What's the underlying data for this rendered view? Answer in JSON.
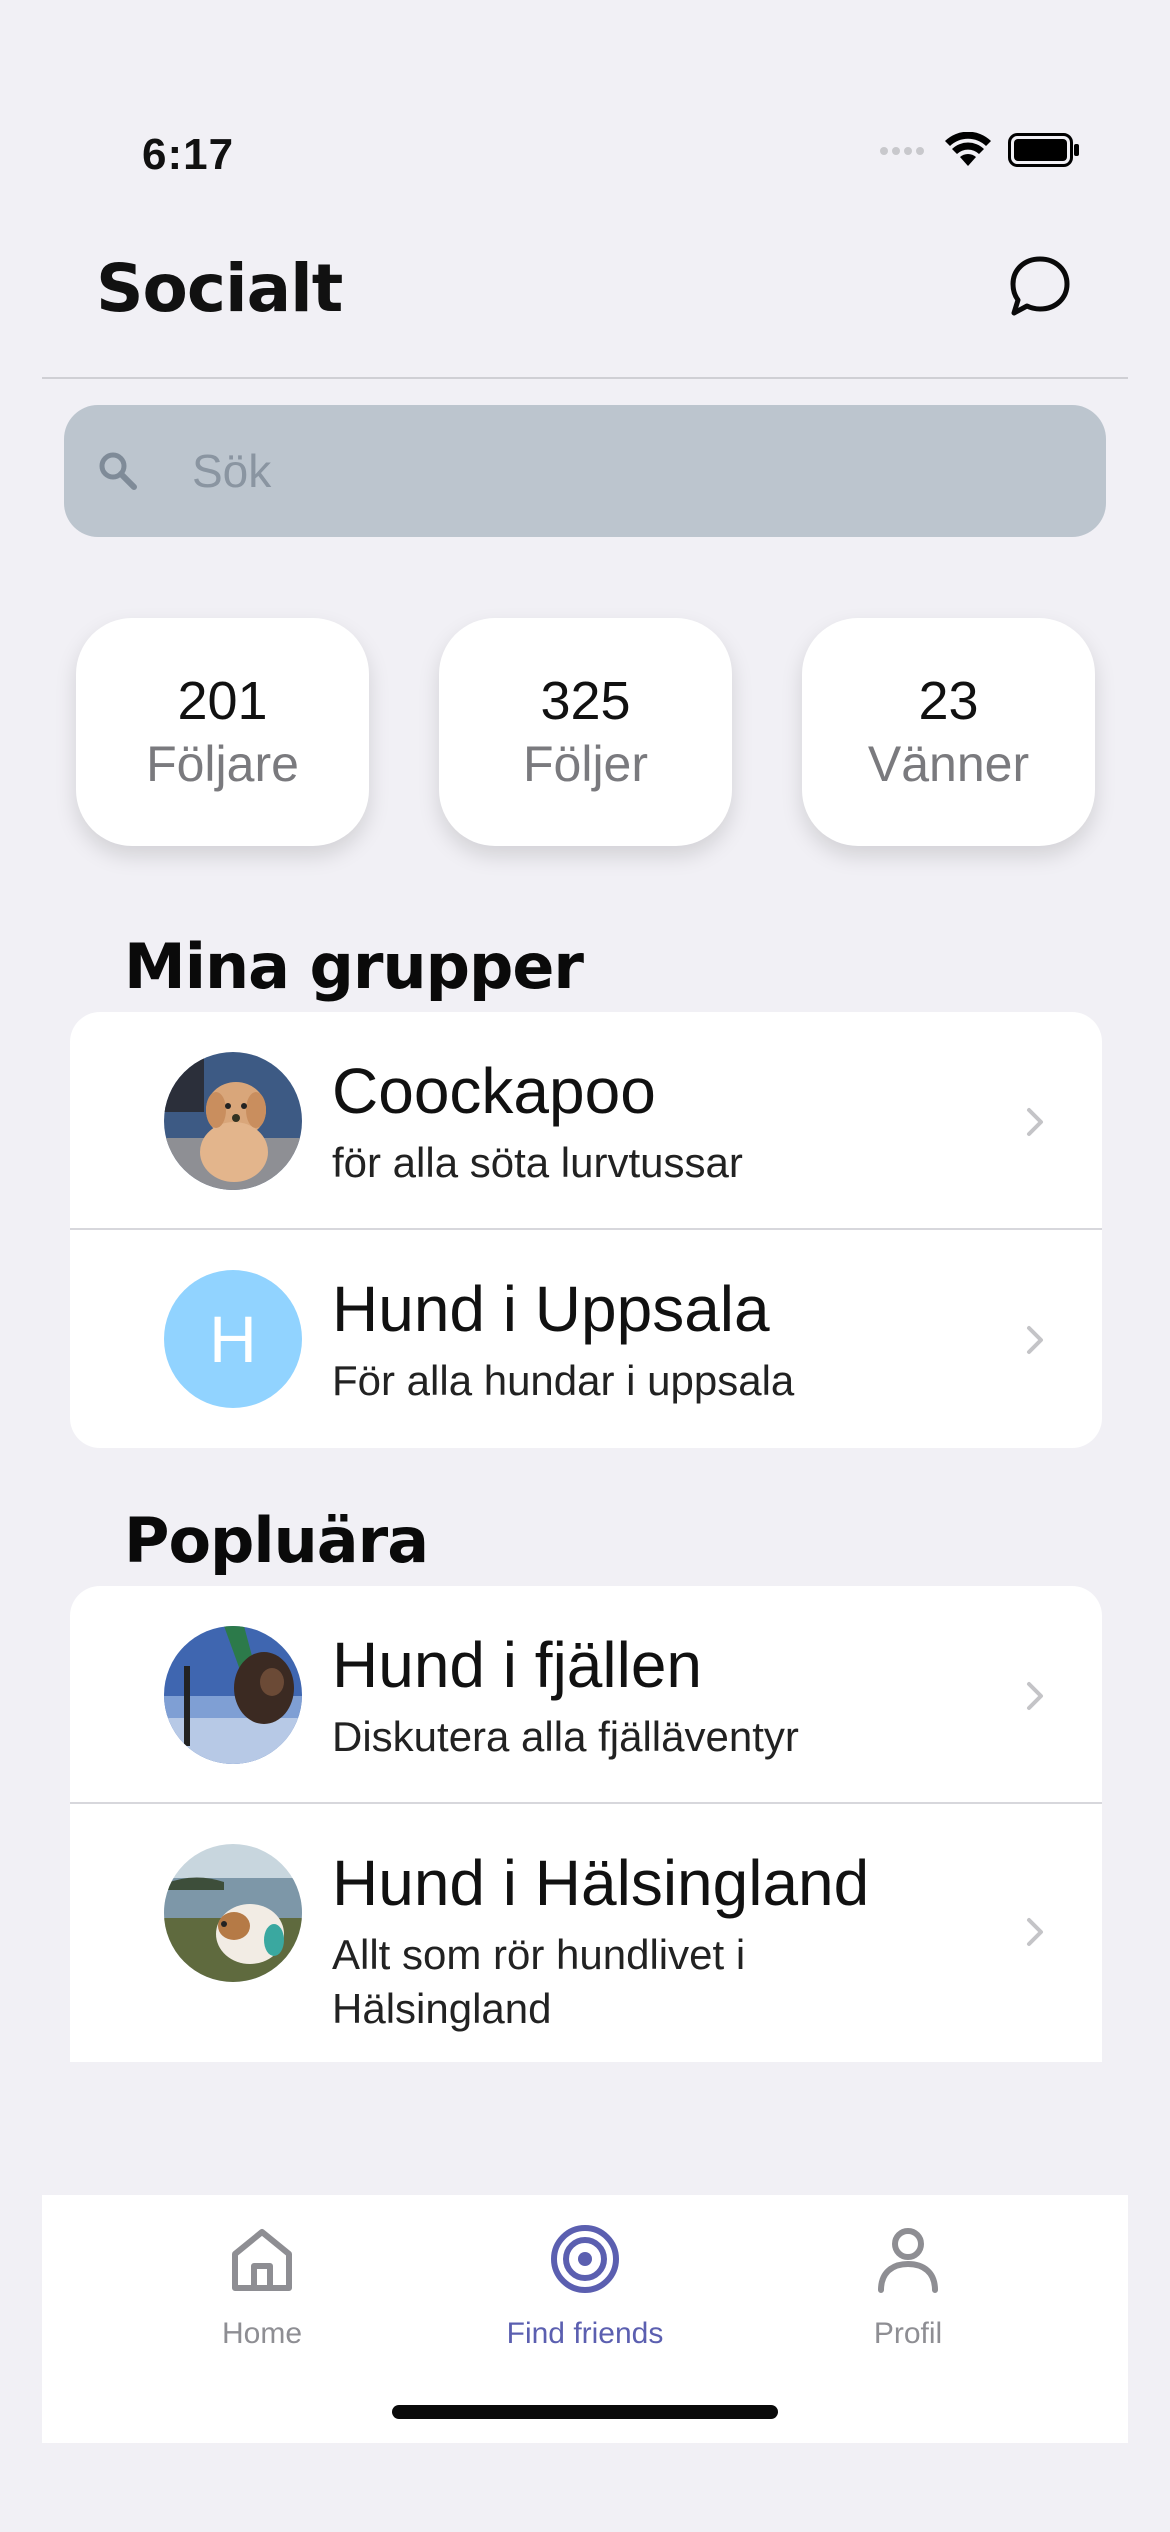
{
  "status": {
    "time": "6:17"
  },
  "header": {
    "title": "Socialt",
    "chat_icon": "chat-bubble-icon"
  },
  "search": {
    "placeholder": "Sök",
    "icon": "search-icon"
  },
  "stats": [
    {
      "value": "201",
      "label": "Följare"
    },
    {
      "value": "325",
      "label": "Följer"
    },
    {
      "value": "23",
      "label": "Vänner"
    }
  ],
  "my_groups": {
    "title": "Mina grupper",
    "items": [
      {
        "name": "Coockapoo",
        "description": "för alla söta lurvtussar",
        "avatar": "photo"
      },
      {
        "name": "Hund i Uppsala",
        "description": "För alla hundar i uppsala",
        "avatar_letter": "H",
        "avatar_color": "#91d3ff"
      }
    ]
  },
  "popular": {
    "title": "Popluära",
    "items": [
      {
        "name": "Hund i fjällen",
        "description": "Diskutera alla fjälläventyr",
        "avatar": "photo"
      },
      {
        "name": "Hund i Hälsingland",
        "description": "Allt som rör hundlivet i Hälsingland",
        "avatar": "photo"
      }
    ]
  },
  "tabs": [
    {
      "label": "Home",
      "icon": "home-icon",
      "active": false
    },
    {
      "label": "Find friends",
      "icon": "target-icon",
      "active": true
    },
    {
      "label": "Profil",
      "icon": "person-icon",
      "active": false
    }
  ],
  "colors": {
    "accent": "#5b5fb0",
    "background": "#f1f0f5",
    "search_bg": "#bcc5ce"
  }
}
